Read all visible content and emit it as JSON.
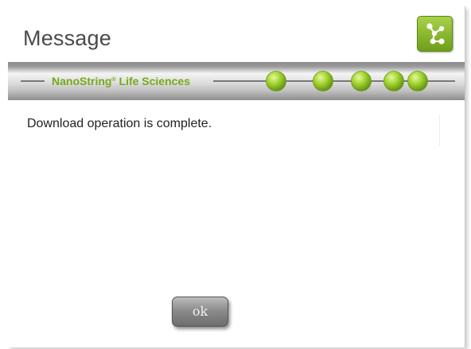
{
  "dialog": {
    "title": "Message",
    "message": "Download operation is complete."
  },
  "banner": {
    "brand_name": "NanoString",
    "brand_mark": "®",
    "brand_suffix": " Life Sciences",
    "bead_count": 5
  },
  "buttons": {
    "ok_label": "ok"
  },
  "icons": {
    "logo": "molecule-network-icon"
  },
  "colors": {
    "brand_green": "#76a91a",
    "bead_green": "#a6d634",
    "title_gray": "#4a4a4a"
  }
}
